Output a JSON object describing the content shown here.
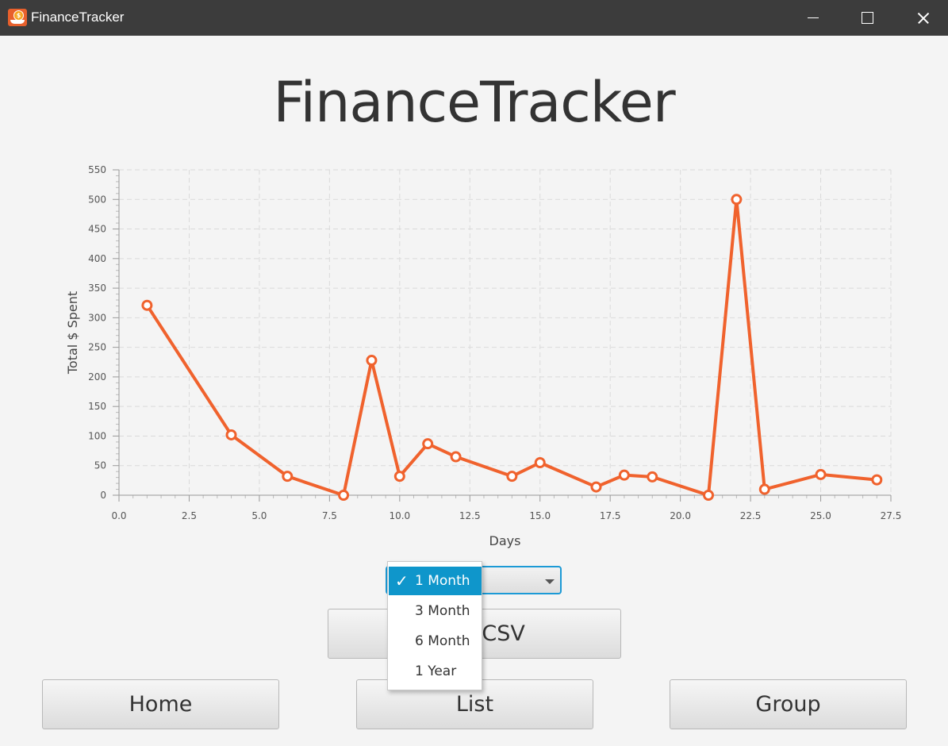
{
  "window": {
    "title": "FinanceTracker"
  },
  "header": {
    "title": "FinanceTracker"
  },
  "chart_data": {
    "type": "line",
    "xlabel": "Days",
    "ylabel": "Total $ Spent",
    "xlim": [
      0,
      27.5
    ],
    "ylim": [
      0,
      550
    ],
    "xticks": [
      "0.0",
      "2.5",
      "5.0",
      "7.5",
      "10.0",
      "12.5",
      "15.0",
      "17.5",
      "20.0",
      "22.5",
      "25.0",
      "27.5"
    ],
    "yticks": [
      "0",
      "50",
      "100",
      "150",
      "200",
      "250",
      "300",
      "350",
      "400",
      "450",
      "500",
      "550"
    ],
    "grid": true,
    "series": [
      {
        "color": "#f0622d",
        "x": [
          1,
          4,
          6,
          8,
          9,
          10,
          11,
          12,
          14,
          15,
          17,
          18,
          19,
          21,
          22,
          23,
          25,
          27
        ],
        "y": [
          321,
          102,
          32,
          0,
          228,
          32,
          87,
          65,
          32,
          55,
          14,
          34,
          31,
          0,
          500,
          10,
          35,
          26
        ]
      }
    ]
  },
  "range_select": {
    "selected": "1 Month",
    "options": [
      "1 Month",
      "3 Month",
      "6 Month",
      "1 Year"
    ]
  },
  "buttons": {
    "load_csv": "Load CSV",
    "home": "Home",
    "list": "List",
    "group": "Group"
  },
  "icons": {
    "check": "✓"
  }
}
